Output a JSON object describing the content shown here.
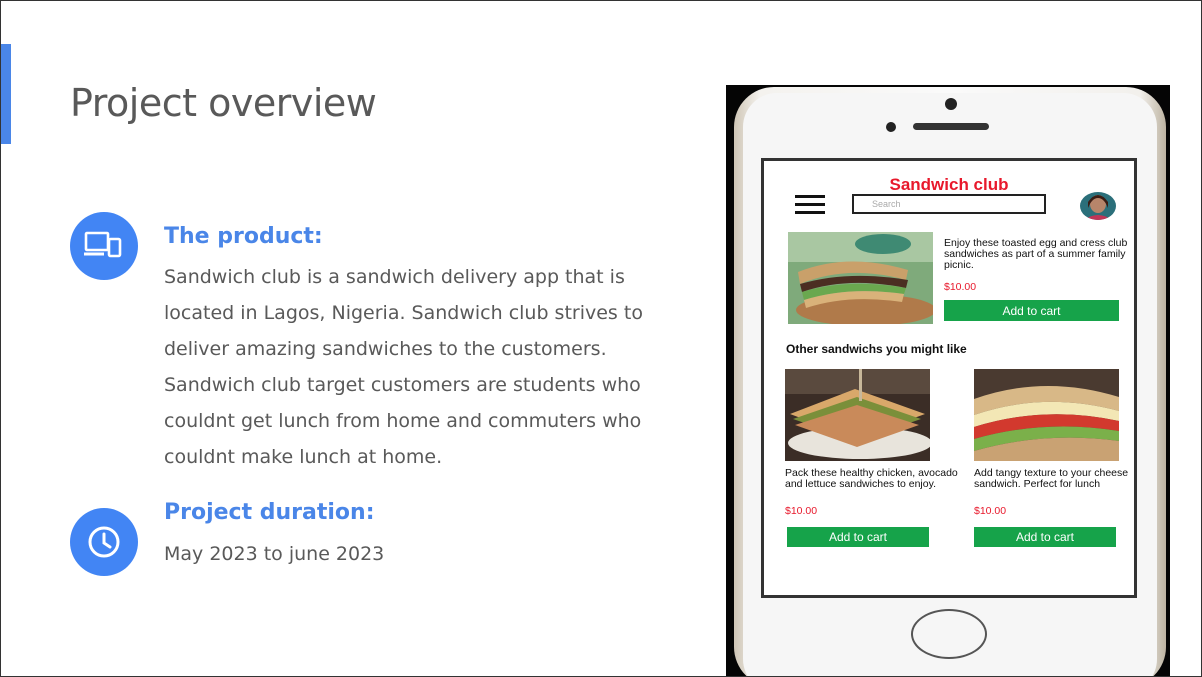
{
  "slide": {
    "title": "Project overview",
    "product": {
      "heading": "The product:",
      "body": "Sandwich club is a sandwich delivery app that is located in Lagos, Nigeria. Sandwich club strives to deliver amazing sandwiches to the customers. Sandwich club target customers are students who couldnt get lunch from home and commuters who couldnt make lunch at home.",
      "icon": "devices-icon"
    },
    "duration": {
      "heading": "Project duration:",
      "body": "May 2023 to june 2023",
      "icon": "clock-icon"
    },
    "accent_color": "#4285f4"
  },
  "app": {
    "title": "Sandwich club",
    "search_placeholder": "Search",
    "featured": {
      "description": "Enjoy these toasted egg and cress club sandwiches as part of a summer family picnic.",
      "price": "$10.00",
      "button": "Add to cart"
    },
    "other_heading": "Other sandwichs you might like",
    "others": [
      {
        "description": "Pack these healthy chicken, avocado and lettuce sandwiches to enjoy.",
        "price": "$10.00",
        "button": "Add to cart"
      },
      {
        "description": "Add tangy texture to your cheese sandwich. Perfect for lunch",
        "price": "$10.00",
        "button": "Add to cart"
      }
    ],
    "colors": {
      "brand": "#e8192c",
      "button": "#16a34a"
    }
  }
}
